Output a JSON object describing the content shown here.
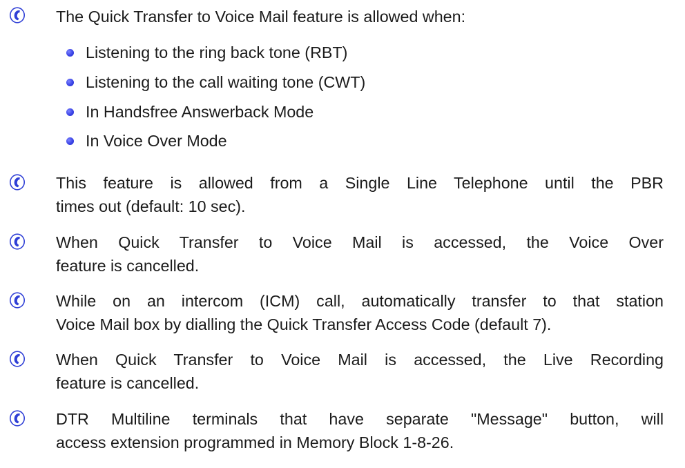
{
  "icon": "phone-handset-icon",
  "colors": {
    "icon_blue": "#2f3fd6",
    "bullet_blue": "#3a43e6",
    "text": "#1b1b1b"
  },
  "intro": "The Quick Transfer to Voice Mail feature is allowed when:",
  "bullets": [
    "Listening to the ring back tone (RBT)",
    "Listening to the call waiting tone (CWT)",
    "In Handsfree Answerback Mode",
    "In Voice Over Mode"
  ],
  "notes": [
    {
      "line1": "This feature is allowed from a Single Line Telephone until the PBR",
      "line2": "times out (default: 10 sec)."
    },
    {
      "line1": "When Quick Transfer to Voice Mail is accessed, the Voice Over",
      "line2": "feature is cancelled."
    },
    {
      "line1": "While on an intercom (ICM) call, automatically transfer to that station",
      "line2": "Voice Mail box by dialling the Quick Transfer Access Code (default 7)."
    },
    {
      "line1": "When Quick Transfer to Voice Mail is accessed, the Live Recording",
      "line2": "feature is cancelled."
    },
    {
      "line1": "DTR Multiline terminals that have separate \"Message\" button, will",
      "line2": "access extension programmed in Memory Block 1-8-26."
    }
  ]
}
